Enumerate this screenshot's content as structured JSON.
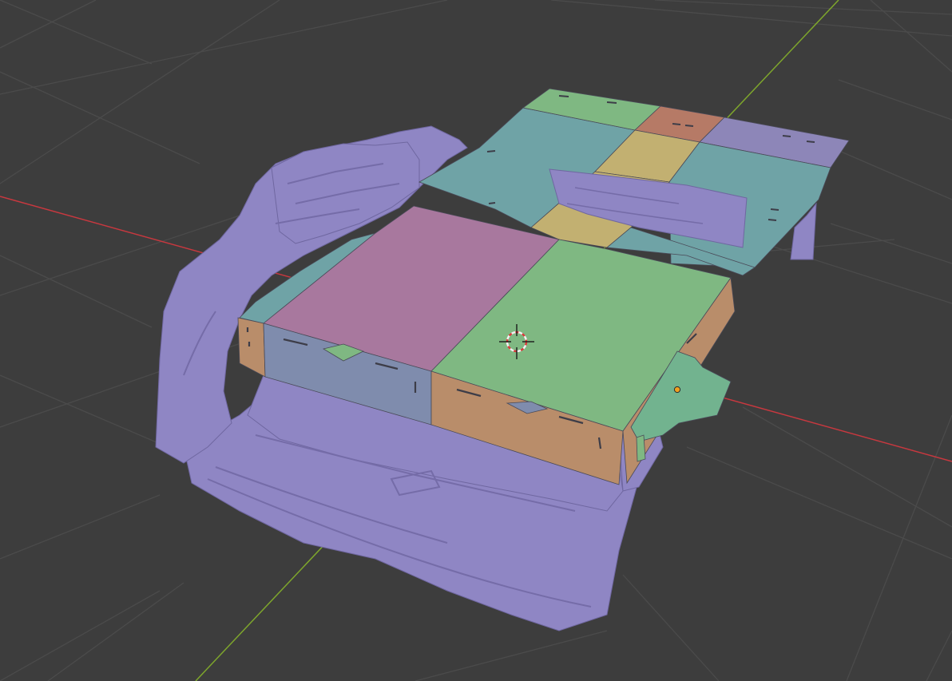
{
  "viewport": {
    "background_color": "#3d3d3d",
    "grid_line_color": "#4b4b4b",
    "x_axis_color": "#c8383f",
    "y_axis_color": "#7ea62c",
    "cursor_icon": "3d-cursor-icon",
    "origin_icon": "object-origin-icon",
    "origin_color": "#f0a020"
  },
  "scene": {
    "scan_mesh_color": "#8f86c4",
    "panel_colors": {
      "teal": "#6fa3a6",
      "green": "#7fb882",
      "pink": "#a8789e",
      "slate": "#7f8cad",
      "orange": "#b98d6a",
      "yellow": "#c2b071",
      "rust": "#b67a66",
      "lavender": "#8d86b8",
      "mint": "#72b38f"
    }
  }
}
